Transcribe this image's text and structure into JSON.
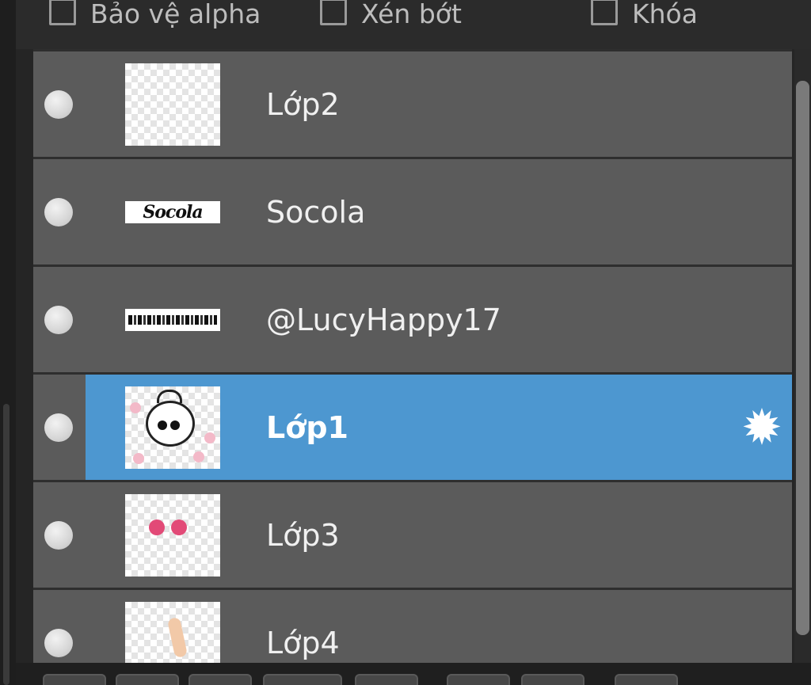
{
  "options": {
    "protect_alpha": "Bảo vệ alpha",
    "clipping": "Xén bớt",
    "lock": "Khóa"
  },
  "layers": [
    {
      "name": "Lớp2",
      "visible": true,
      "selected": false
    },
    {
      "name": "Socola",
      "visible": true,
      "selected": false,
      "thumb_text": "Socola"
    },
    {
      "name": "@LucyHappy17",
      "visible": true,
      "selected": false
    },
    {
      "name": "Lớp1",
      "visible": true,
      "selected": true
    },
    {
      "name": "Lớp3",
      "visible": true,
      "selected": false
    },
    {
      "name": "Lớp4",
      "visible": true,
      "selected": false
    }
  ],
  "icons": {
    "visibility": "circle-dot-icon",
    "layer_settings": "gear-icon"
  },
  "colors": {
    "background": "#252525",
    "row": "#5b5b5b",
    "selected": "#4d97d0",
    "text": "#f0f0f0"
  }
}
